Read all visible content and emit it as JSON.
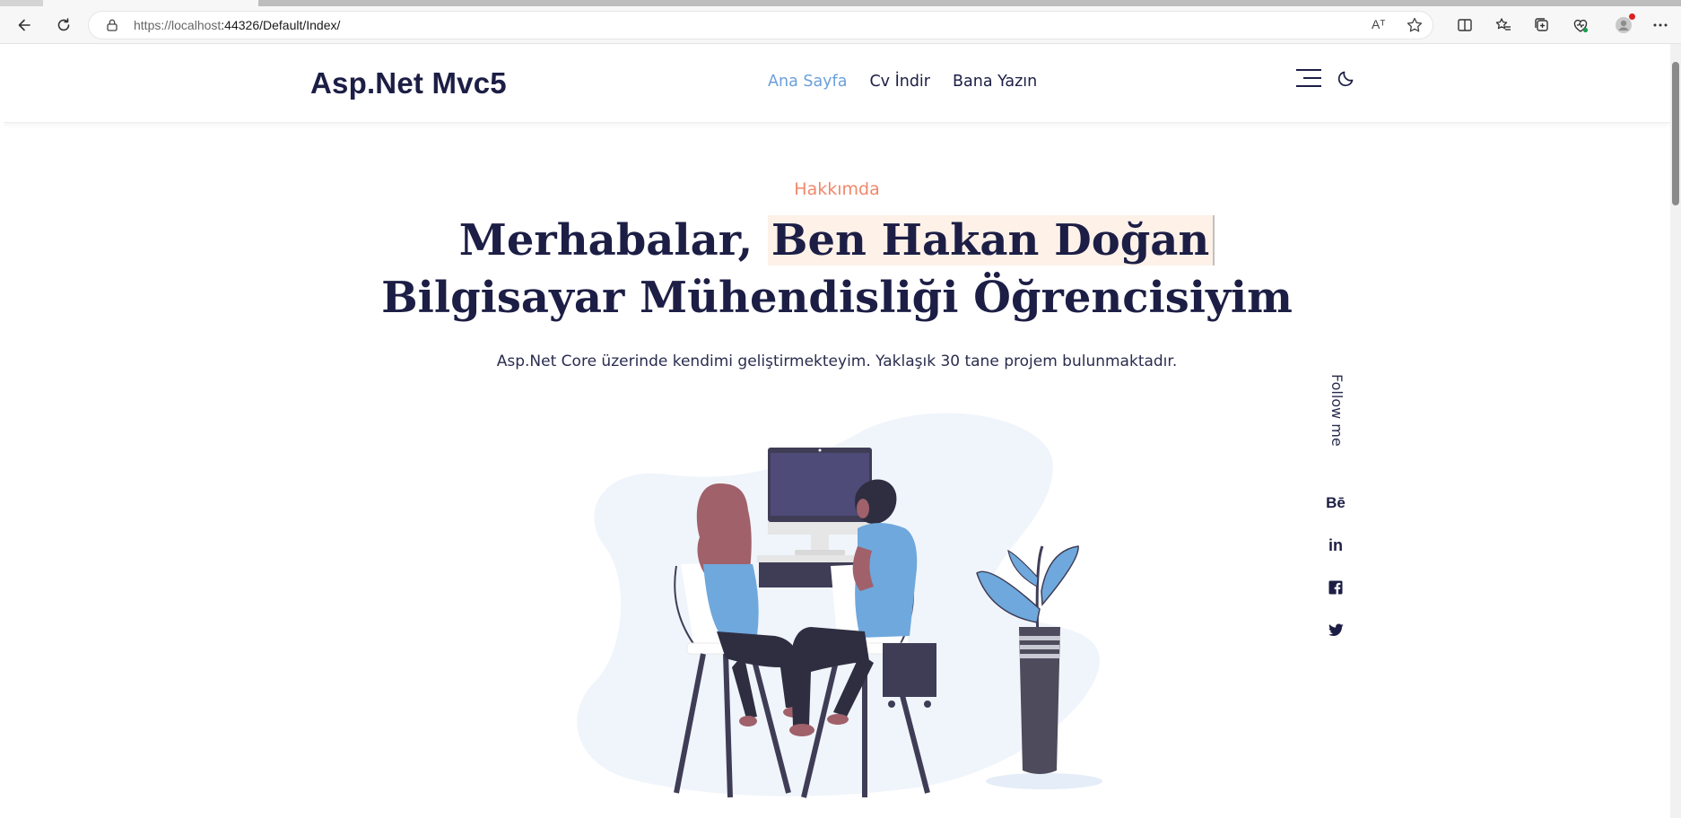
{
  "browser": {
    "url_host": "https://localhost",
    "url_rest": ":44326/Default/Index/",
    "read_aloud_label": "Aᵀ"
  },
  "header": {
    "brand": "Asp.Net Mvc5",
    "nav": [
      {
        "label": "Ana Sayfa",
        "active": true
      },
      {
        "label": "Cv İndir",
        "active": false
      },
      {
        "label": "Bana Yazın",
        "active": false
      }
    ]
  },
  "hero": {
    "eyebrow": "Hakkımda",
    "title_prefix": "Merhabalar,",
    "title_highlight": "Ben Hakan Doğan",
    "title_line2": "Bilgisayar Mühendisliği Öğrencisiyim",
    "subtitle": "Asp.Net Core üzerinde kendimi geliştirmekteyim. Yaklaşık 30 tane projem bulunmaktadır."
  },
  "follow": {
    "label": "Follow me",
    "socials": [
      {
        "name": "behance",
        "glyph": "Bē"
      },
      {
        "name": "linkedin",
        "glyph": "in"
      },
      {
        "name": "facebook",
        "glyph": "f"
      },
      {
        "name": "twitter",
        "glyph": ""
      }
    ]
  },
  "colors": {
    "brand_text": "#1c1e45",
    "active_nav": "#6b9fda",
    "eyebrow": "#f0876b",
    "highlight_bg": "#fdf1e8",
    "illustration_blue": "#6fa8dc",
    "illustration_blob": "#f0f5fb"
  }
}
